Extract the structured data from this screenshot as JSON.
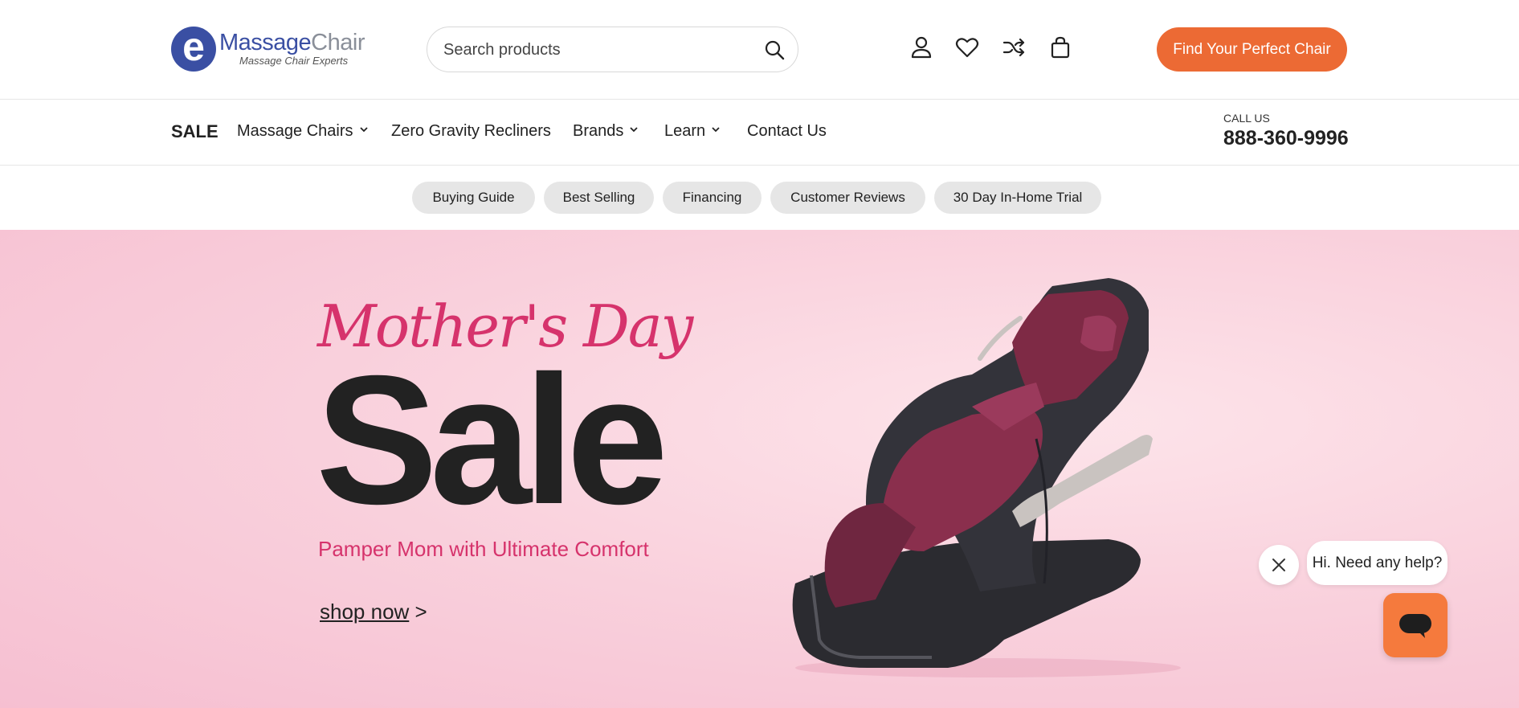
{
  "header": {
    "logo": {
      "letter": "e",
      "word1": "Massage",
      "word2": "Chair",
      "tagline": "Massage Chair Experts"
    },
    "search": {
      "placeholder": "Search products"
    },
    "cta_label": "Find Your Perfect Chair",
    "icons": [
      "account-icon",
      "wishlist-icon",
      "compare-icon",
      "cart-icon"
    ]
  },
  "nav": {
    "items": [
      {
        "label": "SALE",
        "dropdown": false
      },
      {
        "label": "Massage Chairs",
        "dropdown": true
      },
      {
        "label": "Zero Gravity Recliners",
        "dropdown": false
      },
      {
        "label": "Brands",
        "dropdown": true
      },
      {
        "label": "Learn",
        "dropdown": true
      },
      {
        "label": "Contact Us",
        "dropdown": false
      }
    ],
    "call_label": "CALL US",
    "phone": "888-360-9996"
  },
  "pills": [
    "Buying Guide",
    "Best Selling",
    "Financing",
    "Customer Reviews",
    "30 Day In-Home Trial"
  ],
  "hero": {
    "script_title": "Mother's Day",
    "big_title": "Sale",
    "tagline": "Pamper Mom with Ultimate Comfort",
    "shop_link": "shop now",
    "shop_arrow": ">"
  },
  "chat": {
    "greeting": "Hi. Need any help?"
  },
  "colors": {
    "accent": "#ec6a34",
    "brand_blue": "#3a4fa3",
    "hero_pink": "#d6336c",
    "chat_orange": "#f57a3d"
  }
}
